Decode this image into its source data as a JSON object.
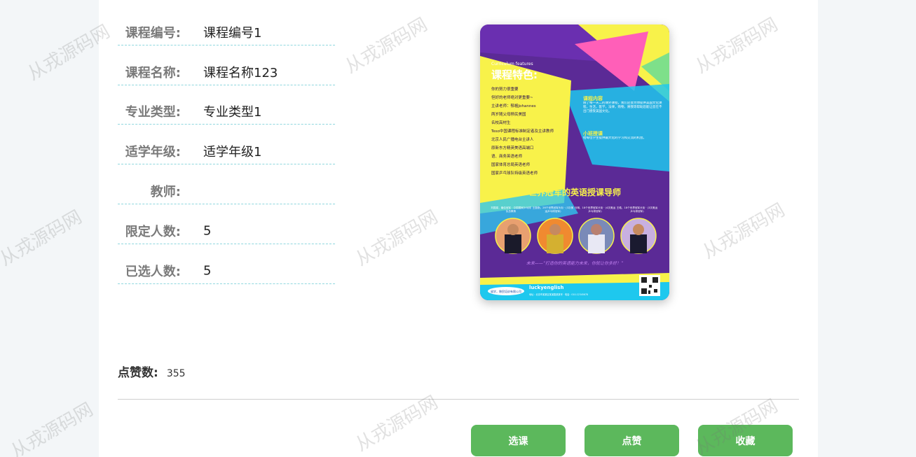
{
  "fields": [
    {
      "label": "课程编号:",
      "value": "课程编号1"
    },
    {
      "label": "课程名称:",
      "value": "课程名称123"
    },
    {
      "label": "专业类型:",
      "value": "专业类型1"
    },
    {
      "label": "适学年级:",
      "value": "适学年级1"
    },
    {
      "label": "教师:",
      "value": ""
    },
    {
      "label": "限定人数:",
      "value": "5"
    },
    {
      "label": "已选人数:",
      "value": "5"
    }
  ],
  "likes": {
    "label": "点赞数:",
    "value": "355"
  },
  "buttons": {
    "select": "选课",
    "like": "点赞",
    "favorite": "收藏"
  },
  "watermark": "从戎源码网",
  "poster": {
    "subtitle_en": "Curriculum features",
    "title": "课程特色:",
    "lines": [
      "你的努力很重要",
      "但好的老师绝对更重要~",
      "主讲老师：郁格Johannes",
      "两岁随父母移民美国",
      "名校高材生",
      "Teso中国课程标准制定者及主讲教师",
      "北京人民广播电台主讲人",
      "原新东方精英美语高端口",
      "语、商务英语老师",
      "国家体育总局英语老师",
      "国家乒乓球队特级英语老师"
    ],
    "side_title_1": "课程内容",
    "side_text_1": "除了每一天二的课外课程，我们还会为你提供美国文化课程，生活，医学，法律，购物，將我等帮助您能让您在不出门感受美国文化。",
    "side_title_2": "小班授课",
    "side_text_2": "给每位学生提供最大化的学习和交流的机会。",
    "headline": "世界冠军的英语授课导师",
    "captions": [
      "刘国梁，最佳冠军 · 中国国家乒乓球队总教练",
      "王励勤，26个世界冠军头衔 · (3次奥运乒乓球冠军)",
      "马琳，18个世界冠军头衔 · (4次奥运乒乓球冠军)",
      "王皓，18个世界冠军头衔 · (3次奥运乒乓球冠军)"
    ],
    "slogan": "未来——“打造你的英语能力未来，你就让你多好！”",
    "brand": "luckyenglish",
    "tagline": "留学，移民培训有限公司",
    "small_print": "地址：北京市某某区某某路某某号 · 电话：010-12345678"
  },
  "colors": {
    "accent": "#5cb85c",
    "dashed": "#8fd7de",
    "poster_purple": "#5b2a96",
    "poster_yellow": "#f8f24a",
    "poster_cyan": "#1ec8ee",
    "poster_pink": "#ff5fb8"
  }
}
